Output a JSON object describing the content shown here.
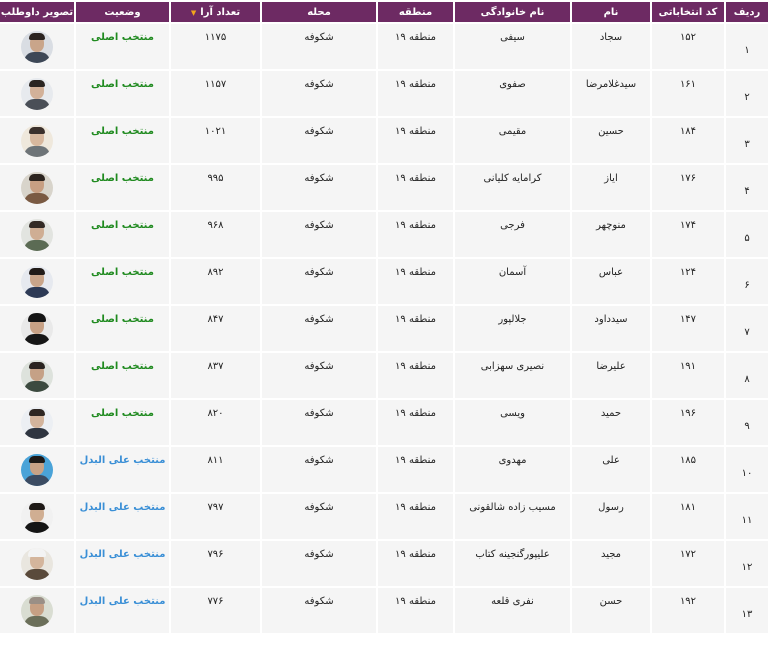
{
  "headers": {
    "radif": "ردیف",
    "code": "کد انتخاباتی",
    "name": "نام",
    "family": "نام خانوادگی",
    "region": "منطقه",
    "neighborhood": "محله",
    "votes": "تعداد آرا",
    "status": "وضعیت",
    "photo": "تصویر داوطلب"
  },
  "sort_indicator": "▼",
  "status_colors": {
    "main": "#1f8a1f",
    "alternate": "#3a8fd6"
  },
  "rows": [
    {
      "radif": "۱",
      "code": "۱۵۲",
      "name": "سجاد",
      "family": "سیفی",
      "region": "منطقه ۱۹",
      "neighborhood": "شکوفه",
      "votes": "۱۱۷۵",
      "status": "منتخب اصلی",
      "status_type": "main",
      "photo": "avatar-photo"
    },
    {
      "radif": "۲",
      "code": "۱۶۱",
      "name": "سیدغلامرضا",
      "family": "صفوی",
      "region": "منطقه ۱۹",
      "neighborhood": "شکوفه",
      "votes": "۱۱۵۷",
      "status": "منتخب اصلی",
      "status_type": "main",
      "photo": "avatar-photo"
    },
    {
      "radif": "۳",
      "code": "۱۸۴",
      "name": "حسین",
      "family": "مقیمی",
      "region": "منطقه ۱۹",
      "neighborhood": "شکوفه",
      "votes": "۱۰۲۱",
      "status": "منتخب اصلی",
      "status_type": "main",
      "photo": "avatar-photo"
    },
    {
      "radif": "۴",
      "code": "۱۷۶",
      "name": "ایاز",
      "family": "کرامایه کلیانی",
      "region": "منطقه ۱۹",
      "neighborhood": "شکوفه",
      "votes": "۹۹۵",
      "status": "منتخب اصلی",
      "status_type": "main",
      "photo": "avatar-photo"
    },
    {
      "radif": "۵",
      "code": "۱۷۴",
      "name": "منوچهر",
      "family": "فرجی",
      "region": "منطقه ۱۹",
      "neighborhood": "شکوفه",
      "votes": "۹۶۸",
      "status": "منتخب اصلی",
      "status_type": "main",
      "photo": "avatar-photo"
    },
    {
      "radif": "۶",
      "code": "۱۲۴",
      "name": "عباس",
      "family": "آسمان",
      "region": "منطقه ۱۹",
      "neighborhood": "شکوفه",
      "votes": "۸۹۲",
      "status": "منتخب اصلی",
      "status_type": "main",
      "photo": "avatar-photo"
    },
    {
      "radif": "۷",
      "code": "۱۴۷",
      "name": "سیدداود",
      "family": "جلالپور",
      "region": "منطقه ۱۹",
      "neighborhood": "شکوفه",
      "votes": "۸۴۷",
      "status": "منتخب اصلی",
      "status_type": "main",
      "photo": "avatar-photo"
    },
    {
      "radif": "۸",
      "code": "۱۹۱",
      "name": "علیرضا",
      "family": "نصیری سهزابی",
      "region": "منطقه ۱۹",
      "neighborhood": "شکوفه",
      "votes": "۸۳۷",
      "status": "منتخب اصلی",
      "status_type": "main",
      "photo": "avatar-photo"
    },
    {
      "radif": "۹",
      "code": "۱۹۶",
      "name": "حمید",
      "family": "ویسی",
      "region": "منطقه ۱۹",
      "neighborhood": "شکوفه",
      "votes": "۸۲۰",
      "status": "منتخب اصلی",
      "status_type": "main",
      "photo": "avatar-photo"
    },
    {
      "radif": "۱۰",
      "code": "۱۸۵",
      "name": "علی",
      "family": "مهدوی",
      "region": "منطقه ۱۹",
      "neighborhood": "شکوفه",
      "votes": "۸۱۱",
      "status": "منتخب علی البدل",
      "status_type": "alternate",
      "photo": "avatar-photo"
    },
    {
      "radif": "۱۱",
      "code": "۱۸۱",
      "name": "رسول",
      "family": "مسیب زاده شالقونی",
      "region": "منطقه ۱۹",
      "neighborhood": "شکوفه",
      "votes": "۷۹۷",
      "status": "منتخب علی البدل",
      "status_type": "alternate",
      "photo": "avatar-photo"
    },
    {
      "radif": "۱۲",
      "code": "۱۷۲",
      "name": "مجید",
      "family": "علیپورگنجینه کتاب",
      "region": "منطقه ۱۹",
      "neighborhood": "شکوفه",
      "votes": "۷۹۶",
      "status": "منتخب علی البدل",
      "status_type": "alternate",
      "photo": "avatar-photo"
    },
    {
      "radif": "۱۳",
      "code": "۱۹۲",
      "name": "حسن",
      "family": "نفری قلعه",
      "region": "منطقه ۱۹",
      "neighborhood": "شکوفه",
      "votes": "۷۷۶",
      "status": "منتخب علی البدل",
      "status_type": "alternate",
      "photo": "avatar-photo"
    }
  ]
}
